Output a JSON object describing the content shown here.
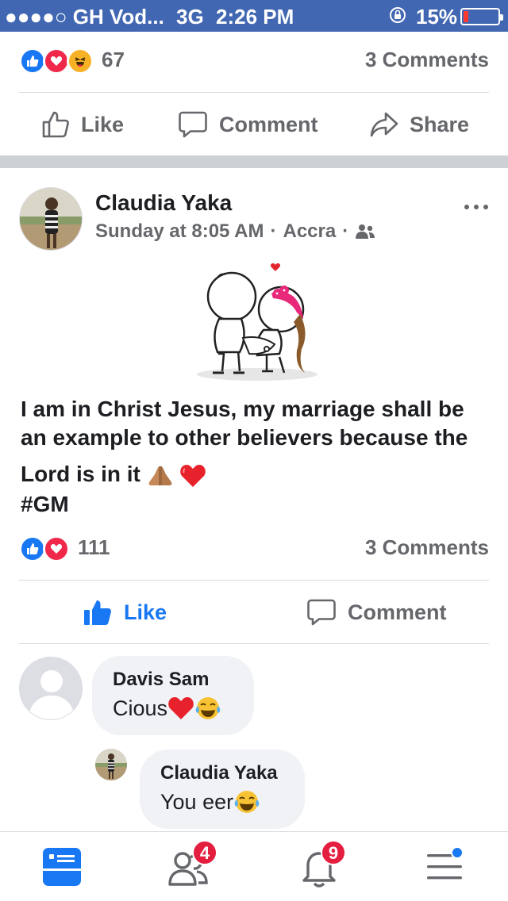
{
  "status_bar": {
    "carrier": "●●●●○ GH Vod...",
    "network": "3G",
    "time": "2:26 PM",
    "battery_percent": "15%",
    "battery_level": 0.15,
    "battery_color": "#ff3b30"
  },
  "prev_post": {
    "reactions": [
      "like-icon",
      "love-icon",
      "haha-icon"
    ],
    "reaction_count": "67",
    "comments_count": "3 Comments",
    "actions": {
      "like": "Like",
      "comment": "Comment",
      "share": "Share"
    }
  },
  "post": {
    "author": "Claudia Yaka",
    "time": "Sunday at 8:05 AM",
    "location": "Accra",
    "privacy_icon": "friends-icon",
    "sticker_icon": "hugging-couple-sticker",
    "text_lines": [
      "I am in Christ Jesus, my marriage shall be",
      "an example to other believers because the",
      "Lord is in it",
      "#GM"
    ],
    "text_emojis": [
      "praying-hands-emoji",
      "red-heart-emoji"
    ],
    "reactions": [
      "like-icon",
      "love-icon"
    ],
    "reaction_count": "111",
    "comments_count": "3 Comments",
    "actions": {
      "like": "Like",
      "comment": "Comment"
    },
    "liked": true
  },
  "comments": [
    {
      "name": "Davis Sam",
      "text": "Cious",
      "emojis": [
        "red-heart-emoji",
        "tears-of-joy-emoji"
      ],
      "avatar": "default-avatar"
    },
    {
      "name": "Claudia Yaka",
      "text": "You eer",
      "emojis": [
        "tears-of-joy-emoji"
      ],
      "avatar": "profile-photo",
      "is_reply": true
    }
  ],
  "tab_bar": {
    "tabs": [
      {
        "icon": "news-feed-icon",
        "active": true
      },
      {
        "icon": "friend-requests-icon",
        "badge": "4"
      },
      {
        "icon": "notifications-icon",
        "badge": "9"
      },
      {
        "icon": "menu-icon",
        "dot": true
      }
    ]
  },
  "colors": {
    "status_bar_bg": "#4267b2",
    "brand_blue": "#1877f2",
    "love_red": "#f0284a",
    "badge_red": "#e41e3f",
    "secondary_text": "#65676b",
    "comment_bubble": "#f0f2f5"
  }
}
